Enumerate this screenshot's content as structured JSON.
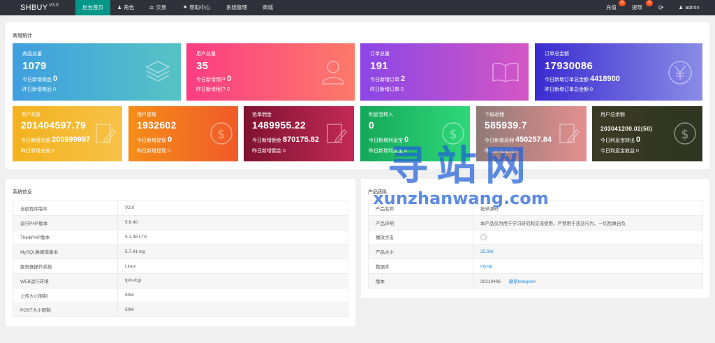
{
  "app": {
    "name": "SHBUY",
    "version": "V3.0"
  },
  "nav": [
    {
      "label": "后台首页",
      "icon": ""
    },
    {
      "label": "角色",
      "icon": "user-icon"
    },
    {
      "label": "交易",
      "icon": "scale-icon"
    },
    {
      "label": "帮助中心",
      "icon": "flag-icon"
    },
    {
      "label": "系统管理",
      "icon": ""
    },
    {
      "label": "商城",
      "icon": ""
    }
  ],
  "right_nav": {
    "recharge": "充值",
    "recharge_badge": "0",
    "withdraw": "提现",
    "withdraw_badge": "0",
    "user": "admin"
  },
  "stats_panel": {
    "title": "商城统计"
  },
  "cards_row1": [
    {
      "title": "商品总量",
      "value": "1079",
      "line1_label": "今日新增商品",
      "line1_value": "0",
      "line2": "昨日新增商品 0",
      "icon": "layers-icon",
      "color_from": "#3f9fe0",
      "color_to": "#57c3c4"
    },
    {
      "title": "用户总量",
      "value": "35",
      "line1_label": "今日新增用户",
      "line1_value": "0",
      "line2": "昨日新增用户 0",
      "icon": "user-icon",
      "color_from": "#fb3d83",
      "color_to": "#fd7a6a"
    },
    {
      "title": "订单总量",
      "value": "191",
      "line1_label": "今日新增订单",
      "line1_value": "2",
      "line2": "昨日新增订单 0",
      "icon": "book-icon",
      "color_from": "#8b46e6",
      "color_to": "#d456c4"
    },
    {
      "title": "订单总金额",
      "value": "17930086",
      "line1_label": "今日新增订单总金额",
      "line1_value": "4418900",
      "line2": "昨日新增订单总金额 0",
      "icon": "yen-icon",
      "color_from": "#3a2bd0",
      "color_to": "#8a8ce6"
    }
  ],
  "cards_row2": [
    {
      "title": "用户充值",
      "value": "201404597.79",
      "line1_label": "今日新增充值",
      "line1_value": "200999997",
      "line2": "昨日新增充值 0",
      "icon": "edit-icon",
      "color_from": "#f3b21e",
      "color_to": "#f7c247"
    },
    {
      "title": "用户提现",
      "value": "1932602",
      "line1_label": "今日新增提现",
      "line1_value": "0",
      "line2": "昨日新增提现 0",
      "icon": "dollar-icon",
      "color_from": "#f58d18",
      "color_to": "#f05a29"
    },
    {
      "title": "抢单佣金",
      "value": "1489955.22",
      "line1_label": "今日新增佣金",
      "line1_value": "870175.82",
      "line2": "昨日新增佣金 0",
      "icon": "edit-icon",
      "color_from": "#7f1230",
      "color_to": "#c22a56"
    },
    {
      "title": "利息宝转入",
      "value": "0",
      "line1_label": "今日新增利息宝",
      "line1_value": "0",
      "line2": "昨日新增利息宝 0",
      "icon": "dollar-icon",
      "color_from": "#16a85a",
      "color_to": "#2ed87a"
    },
    {
      "title": "下级返佣",
      "value": "585939.7",
      "line1_label": "今日新增返佣",
      "line1_value": "450257.84",
      "line2": "昨日新增返佣 0",
      "icon": "edit-icon",
      "color_from": "#8f7a78",
      "color_to": "#e48f8f"
    },
    {
      "title": "用户总余额",
      "value": "203041200.02(50)",
      "line1_label": "今日利息宝转出",
      "line1_value": "0",
      "line2": "今日利息宝收益 0",
      "icon": "dollar-icon",
      "color_from": "#3b3b25",
      "color_to": "#2e3520"
    }
  ],
  "system_panel": {
    "title": "系统信息",
    "rows": [
      [
        "当前程序版本",
        "V3.0"
      ],
      [
        "运行PHP版本",
        "5.6.40"
      ],
      [
        "ThinkPHP版本",
        "5.1.38 LTS"
      ],
      [
        "MySQL数据库版本",
        "5.7.41-log"
      ],
      [
        "服务器操作系统",
        "Linux"
      ],
      [
        "WEB运行环境",
        "fpm-fcgi"
      ],
      [
        "上传大小限制",
        "50M"
      ],
      [
        "POST大小限制",
        "50M"
      ]
    ]
  },
  "product_panel": {
    "title": "产品团队",
    "rows": [
      {
        "k": "产品名称",
        "v": "抢单源码",
        "link": ""
      },
      {
        "k": "产品声明",
        "v": "本产品仅为用于学习研究和交流使用，严禁用于违法行为，一切后果自负",
        "link": ""
      },
      {
        "k": "播放点击",
        "v": "",
        "link": ""
      },
      {
        "k": "产品大小",
        "v": "25.5M",
        "link": ""
      },
      {
        "k": "数据库",
        "v": "mysql",
        "link": ""
      },
      {
        "k": "版本",
        "v": "20210406",
        "link": "联系telegram"
      }
    ]
  },
  "watermark": {
    "main": "寻站网",
    "sub": "xunzhanwang.com"
  }
}
